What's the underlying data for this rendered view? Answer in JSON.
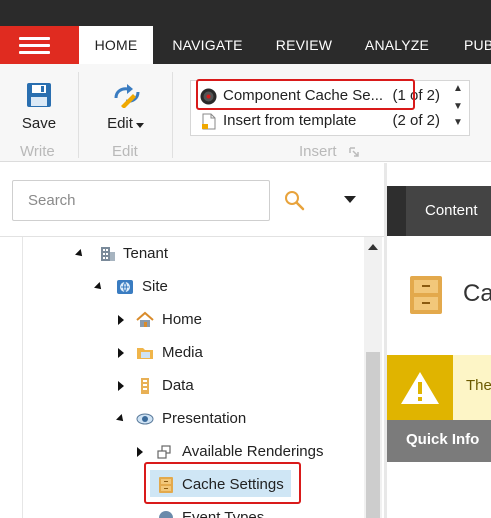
{
  "tabs": [
    {
      "label": "HOME",
      "active": true
    },
    {
      "label": "NAVIGATE",
      "active": false
    },
    {
      "label": "REVIEW",
      "active": false
    },
    {
      "label": "ANALYZE",
      "active": false
    },
    {
      "label": "PUB",
      "active": false
    }
  ],
  "ribbon": {
    "save_label": "Save",
    "write_group": "Write",
    "edit_label": "Edit",
    "edit_group": "Edit",
    "insert_group": "Insert",
    "gallery": [
      {
        "label": "Component Cache Se...",
        "count": "(1 of 2)",
        "icon": "component-icon"
      },
      {
        "label": "Insert from template",
        "count": "(2 of 2)",
        "icon": "template-icon"
      }
    ]
  },
  "search": {
    "placeholder": "Search"
  },
  "tree": [
    {
      "label": "Tenant",
      "icon": "tenant-icon",
      "expanded": true
    },
    {
      "label": "Site",
      "icon": "site-icon",
      "expanded": true
    },
    {
      "label": "Home",
      "icon": "home-icon",
      "expanded": false
    },
    {
      "label": "Media",
      "icon": "media-icon",
      "expanded": false
    },
    {
      "label": "Data",
      "icon": "data-icon",
      "expanded": false
    },
    {
      "label": "Presentation",
      "icon": "presentation-icon",
      "expanded": true
    },
    {
      "label": "Available Renderings",
      "icon": "renderings-icon",
      "expanded": false
    },
    {
      "label": "Cache Settings",
      "icon": "cache-icon",
      "selected": true
    },
    {
      "label": "Event Types",
      "icon": "event-icon"
    }
  ],
  "content": {
    "tab_label": "Content",
    "title": "Ca",
    "warning_text": "The",
    "quick_info": "Quick Info"
  },
  "colors": {
    "accent_red": "#e02b20",
    "highlight_red": "#d91a1a",
    "selected_blue": "#cfe6f5",
    "warning_yellow": "#e0b400"
  }
}
